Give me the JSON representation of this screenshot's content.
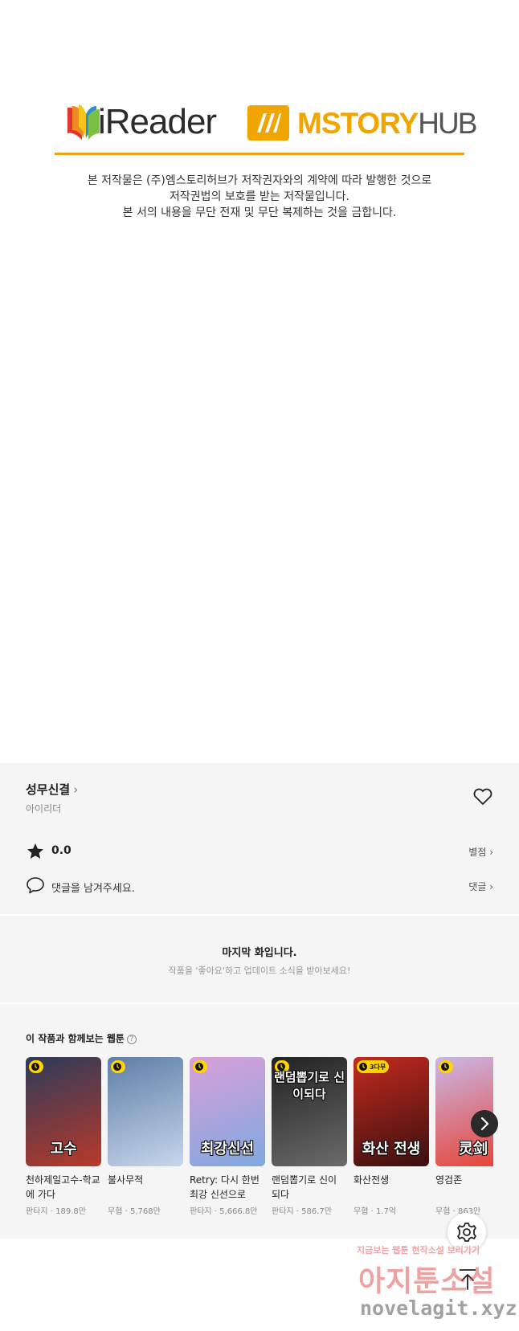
{
  "banner": {
    "ireader_name": "iReader",
    "mstory_name": "MSTORY",
    "mstory_hub": "HUB",
    "notice_lines": [
      "본 저작물은 (주)엠스토리허브가 저작권자와의 계약에 따라 발행한 것으로",
      "저작권법의 보호를 받는 저작물입니다.",
      "본 서의 내용을 무단 전재 및 무단 복제하는 것을 금합니다."
    ],
    "accent_color": "#e8a317"
  },
  "episode": {
    "title": "성무신결",
    "title_chevron": "›",
    "author": "아이리더",
    "rating": "0.0",
    "rating_link": "별점 ›",
    "comment_placeholder": "댓글을 남겨주세요.",
    "comment_link": "댓글 ›"
  },
  "last_notice": {
    "title": "마지막 화입니다.",
    "subtitle": "작품을 '좋아요'하고 업데이트 소식을 받아보세요!"
  },
  "recommendations": {
    "title": "이 작품과 함께보는 웹툰",
    "help": "?",
    "items": [
      {
        "name": "천하제일고수-학교에 가다",
        "genre": "판타지",
        "views": "189.8만",
        "badge": "",
        "cover_text": "고수",
        "colors": [
          "#2c3b5a",
          "#b83a2a"
        ]
      },
      {
        "name": "불사무적",
        "genre": "무협",
        "views": "5,768만",
        "badge": "",
        "cover_text": "",
        "colors": [
          "#5f7ea8",
          "#c7d6ea"
        ]
      },
      {
        "name": "Retry: 다시 한번 최강 신선으로",
        "genre": "판타지",
        "views": "5,666.8만",
        "badge": "",
        "cover_text": "최강신선",
        "colors": [
          "#d9a0d8",
          "#7fa8e0"
        ]
      },
      {
        "name": "랜덤뽑기로 신이 되다",
        "genre": "판타지",
        "views": "586.7만",
        "badge": "",
        "cover_text": "랜덤뽑기로 신이되다",
        "colors": [
          "#222222",
          "#6b6b6b"
        ]
      },
      {
        "name": "화산전생",
        "genre": "무협",
        "views": "1.7억",
        "badge": "3다무",
        "cover_text": "화산 전생",
        "colors": [
          "#c22a1e",
          "#3a1010"
        ]
      },
      {
        "name": "영검존",
        "genre": "무협",
        "views": "863만",
        "badge": "",
        "cover_text": "灵剑",
        "colors": [
          "#c9b8e8",
          "#e84030"
        ]
      }
    ],
    "views_separator": " · "
  },
  "watermark": {
    "line1": "지금보는 웹툰 현작소설 보러가기",
    "line2": "아지툰소설",
    "url": "novelagit.xyz"
  },
  "icons": {
    "heart": "heart-icon",
    "star": "star-icon",
    "comment": "speech-bubble-icon",
    "clock": "clock-icon",
    "next": "chevron-right-icon",
    "settings": "gear-icon",
    "top": "arrow-up-icon"
  }
}
